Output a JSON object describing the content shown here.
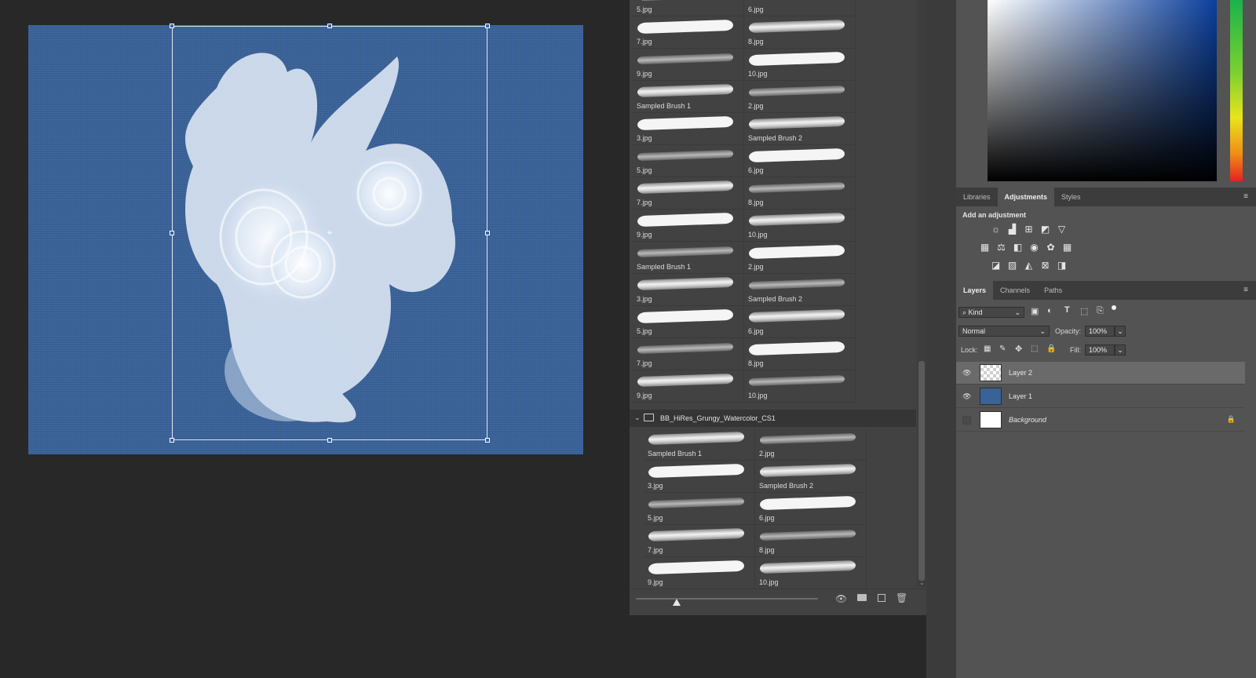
{
  "brush_panel": {
    "top_grid": [
      [
        "5.jpg",
        "6.jpg"
      ],
      [
        "7.jpg",
        "8.jpg"
      ],
      [
        "9.jpg",
        "10.jpg"
      ],
      [
        "Sampled Brush 1",
        "2.jpg"
      ],
      [
        "3.jpg",
        "Sampled Brush 2"
      ],
      [
        "5.jpg",
        "6.jpg"
      ],
      [
        "7.jpg",
        "8.jpg"
      ],
      [
        "9.jpg",
        "10.jpg"
      ],
      [
        "Sampled Brush 1",
        "2.jpg"
      ],
      [
        "3.jpg",
        "Sampled Brush 2"
      ],
      [
        "5.jpg",
        "6.jpg"
      ],
      [
        "7.jpg",
        "8.jpg"
      ],
      [
        "9.jpg",
        "10.jpg"
      ]
    ],
    "folder_name": "BB_HiRes_Grungy_Watercolor_CS1",
    "folder_grid": [
      [
        "Sampled Brush 1",
        "2.jpg"
      ],
      [
        "3.jpg",
        "Sampled Brush 2"
      ],
      [
        "5.jpg",
        "6.jpg"
      ],
      [
        "7.jpg",
        "8.jpg"
      ],
      [
        "9.jpg",
        "10.jpg"
      ]
    ]
  },
  "adjustments_tabs": {
    "libraries": "Libraries",
    "adjustments": "Adjustments",
    "styles": "Styles"
  },
  "adjustments": {
    "heading": "Add an adjustment"
  },
  "layers_tabs": {
    "layers": "Layers",
    "channels": "Channels",
    "paths": "Paths"
  },
  "layers_panel": {
    "filter_kind": "Kind",
    "blend_mode": "Normal",
    "opacity_label": "Opacity:",
    "opacity_value": "100%",
    "lock_label": "Lock:",
    "fill_label": "Fill:",
    "fill_value": "100%",
    "layers": [
      {
        "name": "Layer 2",
        "selected": true,
        "visible": true
      },
      {
        "name": "Layer 1",
        "selected": false,
        "visible": true
      },
      {
        "name": "Background",
        "selected": false,
        "visible": false,
        "locked": true
      }
    ]
  },
  "colors": {
    "canvas_blue": "#3a6298",
    "accent_hue": "#19b34a"
  }
}
